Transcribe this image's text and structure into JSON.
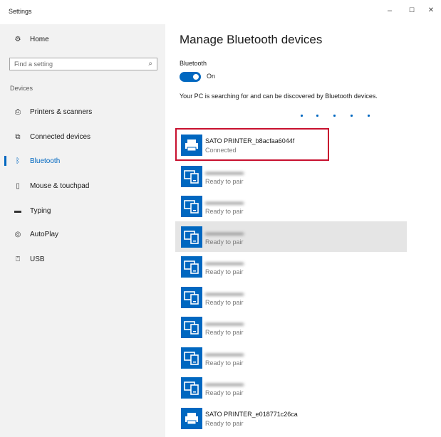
{
  "window": {
    "title": "Settings",
    "controls": {
      "minimize": "–",
      "maximize": "☐",
      "close": "✕"
    }
  },
  "sidebar": {
    "home_label": "Home",
    "search_placeholder": "Find a setting",
    "section_label": "Devices",
    "items": [
      {
        "label": "Printers & scanners",
        "icon": "printer-icon"
      },
      {
        "label": "Connected devices",
        "icon": "connected-devices-icon"
      },
      {
        "label": "Bluetooth",
        "icon": "bluetooth-icon",
        "active": true
      },
      {
        "label": "Mouse & touchpad",
        "icon": "mouse-icon"
      },
      {
        "label": "Typing",
        "icon": "keyboard-icon"
      },
      {
        "label": "AutoPlay",
        "icon": "autoplay-icon"
      },
      {
        "label": "USB",
        "icon": "usb-icon"
      }
    ]
  },
  "main": {
    "title": "Manage Bluetooth devices",
    "bluetooth_label": "Bluetooth",
    "toggle_state": "On",
    "searching_message": "Your PC is searching for and can be discovered by Bluetooth devices.",
    "devices": [
      {
        "name": "SATO PRINTER_b8acfaa6044f",
        "status": "Connected",
        "icon": "printer-icon",
        "highlighted": true
      },
      {
        "name": "",
        "status": "Ready to pair",
        "icon": "device-icon",
        "name_blurred": true
      },
      {
        "name": "",
        "status": "Ready to pair",
        "icon": "device-icon",
        "name_blurred": true
      },
      {
        "name": "",
        "status": "Ready to pair",
        "icon": "device-icon",
        "name_blurred": true,
        "hovered": true
      },
      {
        "name": "",
        "status": "Ready to pair",
        "icon": "device-icon",
        "name_blurred": true
      },
      {
        "name": "",
        "status": "Ready to pair",
        "icon": "device-icon",
        "name_blurred": true
      },
      {
        "name": "",
        "status": "Ready to pair",
        "icon": "device-icon",
        "name_blurred": true
      },
      {
        "name": "",
        "status": "Ready to pair",
        "icon": "device-icon",
        "name_blurred": true
      },
      {
        "name": "",
        "status": "Ready to pair",
        "icon": "device-icon",
        "name_blurred": true
      },
      {
        "name": "SATO PRINTER_e018771c26ca",
        "status": "Ready to pair",
        "icon": "printer-icon"
      }
    ]
  },
  "colors": {
    "accent": "#0067c0",
    "highlight_border": "#c8102e",
    "sidebar_bg": "#f2f2f2",
    "hover_bg": "#e5e5e5"
  }
}
